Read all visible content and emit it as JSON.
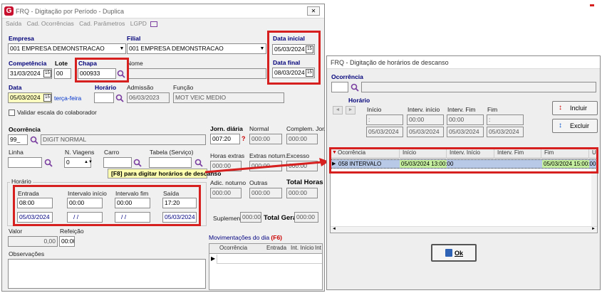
{
  "main": {
    "title": "FRQ - Digitação por Período - Duplica",
    "close_label": "✕",
    "menu": [
      "Saída",
      "Cad. Ocorrências",
      "Cad. Parâmetros",
      "LGPD"
    ],
    "empresa": {
      "label": "Empresa",
      "value": "001 EMPRESA DEMONSTRACAO"
    },
    "filial": {
      "label": "Filial",
      "value": "001 EMPRESA DEMONSTRACAO"
    },
    "data_inicial": {
      "label": "Data inicial",
      "value": "05/03/2024"
    },
    "data_final": {
      "label": "Data final",
      "value": "08/03/2024"
    },
    "competencia": {
      "label": "Competência",
      "value": "31/03/2024"
    },
    "lote": {
      "label": "Lote",
      "value": "00"
    },
    "chapa": {
      "label": "Chapa",
      "value": "000933"
    },
    "nome": {
      "label": "Nome",
      "value": ""
    },
    "data": {
      "label": "Data",
      "value": "05/03/2024",
      "weekday": "terça-feira"
    },
    "horario_label": "Horário",
    "admissao": {
      "label": "Admissão",
      "value": "06/03/2023"
    },
    "funcao": {
      "label": "Função",
      "value": "MOT VEIC MEDIO"
    },
    "validar_escala": "Validar escala do colaborador",
    "ocorrencia": {
      "label": "Ocorrência",
      "code": "99_",
      "desc": "DIGIT NORMAL"
    },
    "linha_label": "Linha",
    "n_viagens": {
      "label": "N. Viagens",
      "value": "0"
    },
    "carro_label": "Carro",
    "tabela_label": "Tabela (Serviço)",
    "f8_hint": "[F8] para digitar horários de descanso",
    "jornada": {
      "jorn_label": "Jorn. diária",
      "jorn_value": "007:20",
      "jorn_q": "?",
      "normal_label": "Normal",
      "normal_value": "000:00",
      "complem_label": "Complem. Jor.",
      "complem_value": "000:00",
      "horas_extras_label": "Horas extras",
      "horas_extras_value": "000:00",
      "extras_noturn_label": "Extras noturn.",
      "extras_noturn_value": "000:00",
      "excesso_label": "Excesso",
      "excesso_value": "000:00",
      "adic_noturno_label": "Adic. noturno",
      "adic_noturno_value": "000:00",
      "outras_label": "Outras",
      "outras_value": "000:00",
      "total_horas_label": "Total Horas",
      "total_horas_value": "000:00",
      "suplementar_label": "Suplementar",
      "suplementar_value": "000:00",
      "total_geral_label": "Total Geral",
      "total_geral_value": "000:00"
    },
    "horario_group": {
      "title": "Horário",
      "entrada_label": "Entrada",
      "entrada_value": "08:00",
      "entrada_date": "05/03/2024",
      "int_inicio_label": "Intervalo início",
      "int_inicio_value": "00:00",
      "int_inicio_date": "/ /",
      "int_fim_label": "Intervalo fim",
      "int_fim_value": "00:00",
      "int_fim_date": "/ /",
      "saida_label": "Saída",
      "saida_value": "17:20",
      "saida_date": "05/03/2024"
    },
    "valor": {
      "label": "Valor",
      "value": "0,00"
    },
    "refeicao": {
      "label": "Refeição",
      "value": "00:00"
    },
    "observacoes_label": "Observações",
    "movimentacoes": {
      "title": "Movimentações do dia",
      "key": "(F6)",
      "columns": [
        "Ocorrência",
        "Entrada",
        "Int. Início",
        "Int"
      ]
    }
  },
  "descanso": {
    "title": "FRQ - Digitação de horários de descanso",
    "ocorrencia_label": "Ocorrência",
    "horario_label": "Horário",
    "inicio_label": "Início",
    "inicio_time": ":",
    "inicio_date": "05/03/2024",
    "int_inicio_label": "Interv. início",
    "int_inicio_time": "00:00",
    "int_inicio_date": "05/03/2024",
    "int_fim_label": "Interv. Fim",
    "int_fim_time": "00:00",
    "int_fim_date": "05/03/2024",
    "fim_label": "Fim",
    "fim_time": ":",
    "fim_date": "05/03/2024",
    "incluir_label": "Incluir",
    "excluir_label": "Excluir",
    "grid_columns": [
      "Ocorrência",
      "Início",
      "Interv. Início",
      "Interv. Fim",
      "Fim",
      "U"
    ],
    "grid_row": {
      "ocorrencia": "058 INTERVALO",
      "inicio": "05/03/2024 13:00:00",
      "int_inicio": "",
      "int_fim": "",
      "fim": "05/03/2024 15:00:00"
    },
    "ok_label": "Ok"
  },
  "colors": {
    "highlight_red": "#d61f1f",
    "row_green": "#c6f0a0",
    "label_blue": "#00007a"
  }
}
